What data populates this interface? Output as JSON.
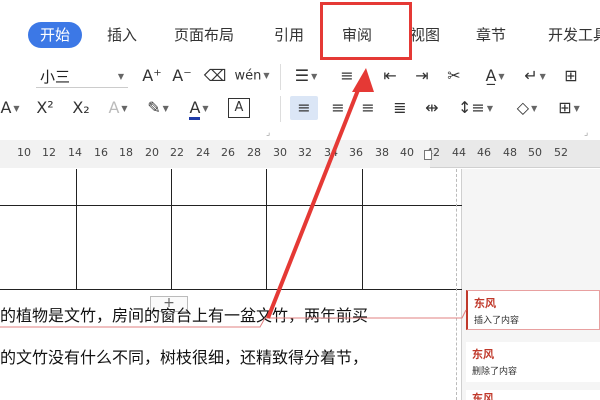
{
  "menu": {
    "tabs": [
      {
        "label": "开始",
        "active": true
      },
      {
        "label": "插入"
      },
      {
        "label": "页面布局"
      },
      {
        "label": "引用"
      },
      {
        "label": "审阅",
        "highlighted": true
      },
      {
        "label": "视图"
      },
      {
        "label": "章节"
      },
      {
        "label": "开发工具"
      }
    ]
  },
  "toolbar": {
    "font_size": "小三",
    "font_color": "#1e3aa8",
    "font_size_increase": "A⁺",
    "font_size_decrease": "A⁻",
    "superscript": "X²",
    "subscript": "X₂",
    "phonetic": "wén",
    "highlight_char": "A"
  },
  "ruler": {
    "numbers": [
      "10",
      "12",
      "14",
      "16",
      "18",
      "20",
      "22",
      "24",
      "26",
      "28",
      "30",
      "32",
      "34",
      "36",
      "38",
      "40",
      "42",
      "44",
      "46",
      "48",
      "50",
      "52"
    ]
  },
  "document": {
    "line1": "的植物是文竹，房间的窗台上有一盆文竹，两年前买",
    "line2": "的文竹没有什么不同，树枝很细，还精致得分着节，",
    "table_add": "+"
  },
  "comments": [
    {
      "author": "东风",
      "action": "插入了内容"
    },
    {
      "author": "东风",
      "action": "删除了内容"
    },
    {
      "author": "东风",
      "action": ""
    }
  ],
  "colors": {
    "accent": "#3c78e6",
    "annotation": "#e53935",
    "comment_accent": "#c0392b"
  }
}
